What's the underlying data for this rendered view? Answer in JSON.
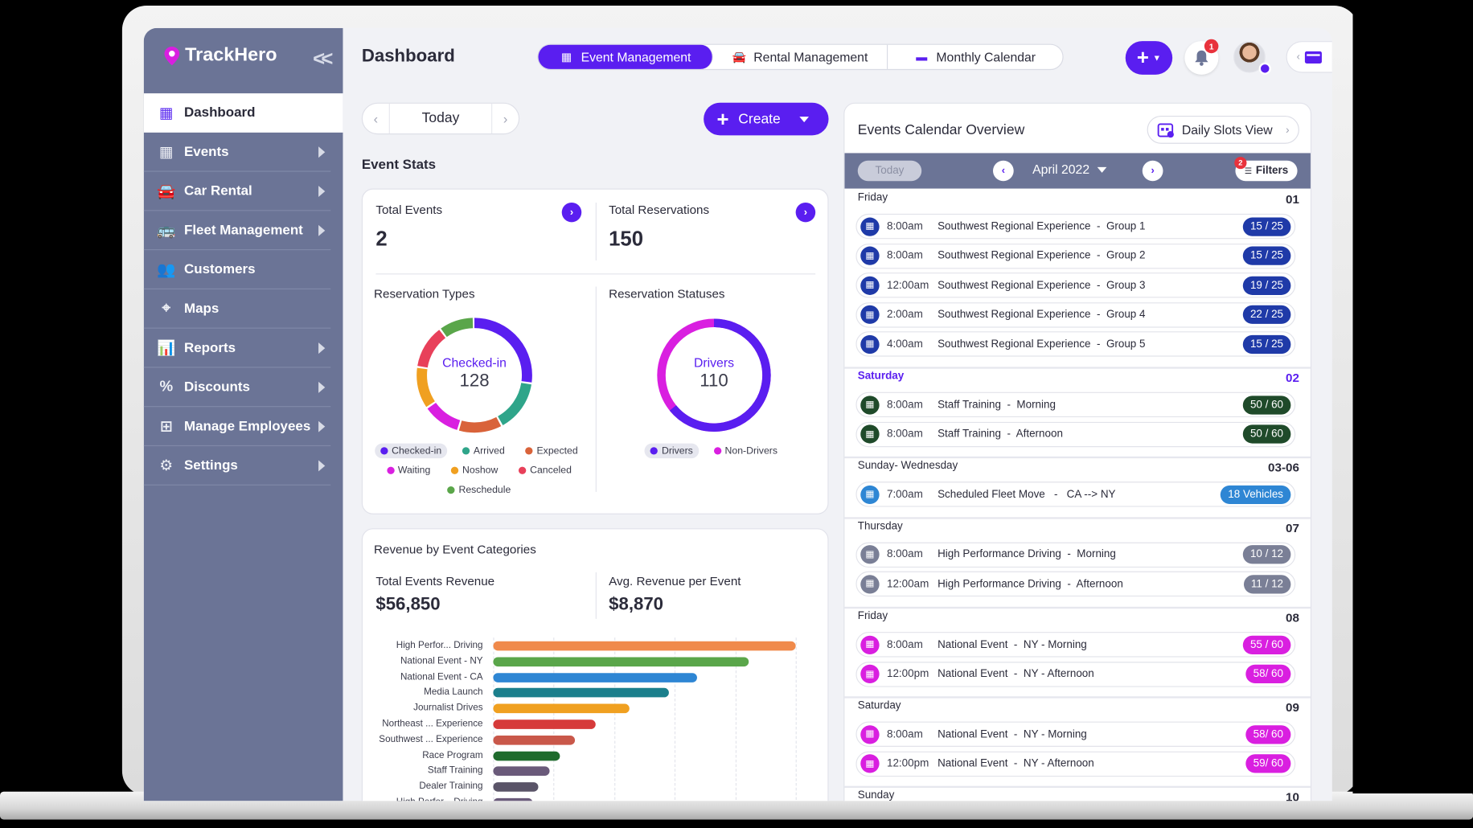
{
  "app": {
    "name": "TrackHero",
    "page_title": "Dashboard"
  },
  "sidebar": {
    "items": [
      {
        "label": "Dashboard",
        "icon": "grid-icon",
        "active": true,
        "arrow": false
      },
      {
        "label": "Events",
        "icon": "calendar-grid-icon",
        "arrow": true
      },
      {
        "label": "Car Rental",
        "icon": "car-icon",
        "arrow": true
      },
      {
        "label": "Fleet Management",
        "icon": "bus-icon",
        "arrow": true
      },
      {
        "label": "Customers",
        "icon": "users-icon",
        "arrow": false
      },
      {
        "label": "Maps",
        "icon": "map-pin-icon",
        "arrow": false
      },
      {
        "label": "Reports",
        "icon": "chart-icon",
        "arrow": true
      },
      {
        "label": "Discounts",
        "icon": "tag-icon",
        "arrow": true
      },
      {
        "label": "Manage Employees",
        "icon": "org-chart-icon",
        "arrow": true
      },
      {
        "label": "Settings",
        "icon": "gear-icon",
        "arrow": true
      }
    ]
  },
  "header": {
    "tabs": [
      {
        "label": "Event Management",
        "active": true
      },
      {
        "label": "Rental Management"
      },
      {
        "label": "Monthly Calendar"
      }
    ],
    "notification_count": "1",
    "colors": {
      "primary": "#5a1ef0",
      "sidebar": "#6b7496",
      "alert": "#e8323c"
    }
  },
  "toolbar": {
    "today_label": "Today",
    "create_label": "Create"
  },
  "event_stats": {
    "section_label": "Event Stats",
    "total_events_label": "Total Events",
    "total_events": "2",
    "total_reservations_label": "Total Reservations",
    "total_reservations": "150",
    "types_title": "Reservation Types",
    "types_center_label": "Checked-in",
    "types_center_value": "128",
    "statuses_title": "Reservation Statuses",
    "statuses_center_label": "Drivers",
    "statuses_center_value": "110",
    "types_legend": [
      {
        "label": "Checked-in",
        "color": "#5a1ef0",
        "highlight": true
      },
      {
        "label": "Arrived",
        "color": "#2fa58a"
      },
      {
        "label": "Expected",
        "color": "#d9633a"
      },
      {
        "label": "Waiting",
        "color": "#d91fe0"
      },
      {
        "label": "Noshow",
        "color": "#f0a020"
      },
      {
        "label": "Canceled",
        "color": "#e8405a"
      },
      {
        "label": "Reschedule",
        "color": "#5aa64a"
      }
    ],
    "statuses_legend": [
      {
        "label": "Drivers",
        "color": "#5a1ef0",
        "highlight": true
      },
      {
        "label": "Non-Drivers",
        "color": "#d91fe0"
      }
    ]
  },
  "revenue": {
    "title": "Revenue by Event Categories",
    "total_label": "Total Events Revenue",
    "total_value": "$56,850",
    "avg_label": "Avg. Revenue per Event",
    "avg_value": "$8,870"
  },
  "chart_data": {
    "type": "bar",
    "orientation": "horizontal",
    "categories": [
      "High Perfor... Driving",
      "National Event - NY",
      "National Event - CA",
      "Media Launch",
      "Journalist Drives",
      "Northeast ... Experience",
      "Southwest ... Experience",
      "Race Program",
      "Staff Training",
      "Dealer Training",
      "High Perfor... Driving"
    ],
    "values": [
      100,
      84.5,
      67.5,
      58,
      45,
      34,
      27,
      22,
      18.5,
      15,
      13
    ],
    "colors": [
      "#f08a4b",
      "#5aa64a",
      "#2e86d4",
      "#1b7f8c",
      "#f0a020",
      "#d63a3a",
      "#c9584a",
      "#1f6b2d",
      "#6a5a7a",
      "#5a5468",
      "#6a5a7a"
    ],
    "xlim": [
      0,
      100
    ],
    "grid": true
  },
  "calendar": {
    "title": "Events Calendar Overview",
    "view_label": "Daily Slots View",
    "today_label": "Today",
    "month_label": "April 2022",
    "filters_label": "Filters",
    "filters_count": "2",
    "days": [
      {
        "name": "Friday",
        "date": "01",
        "events": [
          {
            "time": "8:00am",
            "name": "Southwest Regional Experience  -  Group 1",
            "badge": "15 / 25",
            "color": "#1f3aa8"
          },
          {
            "time": "8:00am",
            "name": "Southwest Regional Experience  -  Group 2",
            "badge": "15 / 25",
            "color": "#1f3aa8"
          },
          {
            "time": "12:00am",
            "name": "Southwest Regional Experience  -  Group 3",
            "badge": "19 / 25",
            "color": "#1f3aa8"
          },
          {
            "time": "2:00am",
            "name": "Southwest Regional Experience  -  Group 4",
            "badge": "22 / 25",
            "color": "#1f3aa8"
          },
          {
            "time": "4:00am",
            "name": "Southwest Regional Experience  -  Group 5",
            "badge": "15 / 25",
            "color": "#1f3aa8"
          }
        ]
      },
      {
        "name": "Saturday",
        "date": "02",
        "highlight": true,
        "events": [
          {
            "time": "8:00am",
            "name": "Staff Training  -  Morning",
            "badge": "50 / 60",
            "color": "#1f4a2a"
          },
          {
            "time": "8:00am",
            "name": "Staff Training  -  Afternoon",
            "badge": "50 / 60",
            "color": "#1f4a2a"
          }
        ]
      },
      {
        "name": "Sunday- Wednesday",
        "date": "03-06",
        "events": [
          {
            "time": "7:00am",
            "name": "Scheduled Fleet Move   -   CA --> NY",
            "badge": "18 Vehicles",
            "color": "#2e86d4"
          }
        ]
      },
      {
        "name": "Thursday",
        "date": "07",
        "events": [
          {
            "time": "8:00am",
            "name": "High Performance Driving  -  Morning",
            "badge": "10 / 12",
            "color": "#7a7f96"
          },
          {
            "time": "12:00am",
            "name": "High Performance Driving  -  Afternoon",
            "badge": "11 / 12",
            "color": "#7a7f96"
          }
        ]
      },
      {
        "name": "Friday",
        "date": "08",
        "events": [
          {
            "time": "8:00am",
            "name": "National Event  -  NY - Morning",
            "badge": "55 / 60",
            "color": "#d91fe0"
          },
          {
            "time": "12:00pm",
            "name": "National Event  -  NY - Afternoon",
            "badge": "58/ 60",
            "color": "#d91fe0"
          }
        ]
      },
      {
        "name": "Saturday",
        "date": "09",
        "events": [
          {
            "time": "8:00am",
            "name": "National Event  -  NY - Morning",
            "badge": "58/ 60",
            "color": "#d91fe0"
          },
          {
            "time": "12:00pm",
            "name": "National Event  -  NY - Afternoon",
            "badge": "59/ 60",
            "color": "#d91fe0"
          }
        ]
      },
      {
        "name": "Sunday",
        "date": "10",
        "events": []
      }
    ]
  }
}
